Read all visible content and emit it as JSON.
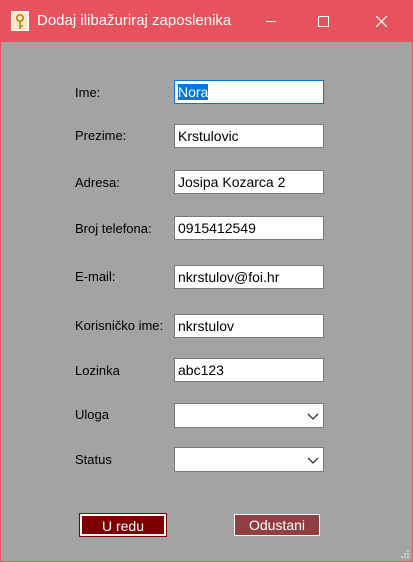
{
  "window": {
    "title": "Dodaj ilibažuriraj zaposlenika",
    "accent_color": "#e8525d",
    "background_color": "#a3a3a3",
    "icon": "key-app-icon",
    "controls": [
      "minimize-icon",
      "maximize-icon",
      "close-icon"
    ]
  },
  "form": {
    "ime": {
      "label": "Ime:",
      "value": "Nora"
    },
    "prezime": {
      "label": "Prezime:",
      "value": "Krstulovic"
    },
    "adresa": {
      "label": "Adresa:",
      "value": "Josipa Kozarca 2"
    },
    "telefon": {
      "label": "Broj telefona:",
      "value": "0915412549"
    },
    "email": {
      "label": "E-mail:",
      "value": "nkrstulov@foi.hr"
    },
    "korisnicko_ime": {
      "label": "Korisničko ime:",
      "value": "nkrstulov"
    },
    "lozinka": {
      "label": "Lozinka",
      "value": "abc123"
    },
    "uloga": {
      "label": "Uloga",
      "value": ""
    },
    "status": {
      "label": "Status",
      "value": ""
    }
  },
  "buttons": {
    "ok_label": "U redu",
    "cancel_label": "Odustani",
    "ok_color": "#7d0000",
    "cancel_color": "#8f3f3f"
  }
}
